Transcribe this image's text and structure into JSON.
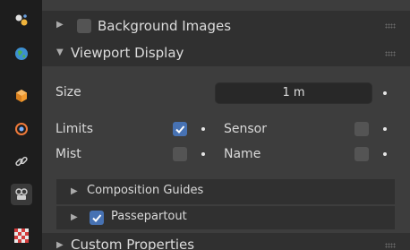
{
  "panels": {
    "background_images": {
      "label": "Background Images",
      "checked": false,
      "expanded": false
    },
    "viewport_display": {
      "label": "Viewport Display",
      "expanded": true
    },
    "custom_properties": {
      "label": "Custom Properties",
      "expanded": false
    }
  },
  "viewport_display": {
    "size": {
      "label": "Size",
      "value": "1 m"
    },
    "limits": {
      "label": "Limits",
      "checked": true
    },
    "sensor": {
      "label": "Sensor",
      "checked": false
    },
    "mist": {
      "label": "Mist",
      "checked": false
    },
    "name": {
      "label": "Name",
      "checked": false
    },
    "composition_guides": {
      "label": "Composition Guides",
      "expanded": false
    },
    "passepartout": {
      "label": "Passepartout",
      "checked": true,
      "expanded": false
    }
  },
  "sidebar_tabs": [
    {
      "icon": "scene-icon"
    },
    {
      "icon": "world-icon"
    },
    {
      "icon": "object-icon"
    },
    {
      "icon": "physics-icon"
    },
    {
      "icon": "constraints-icon"
    },
    {
      "icon": "camera-data-icon",
      "active": true
    },
    {
      "icon": "texture-icon"
    }
  ],
  "colors": {
    "accent": "#4772b3",
    "panel_bg": "#3d3d3d",
    "header_bg": "#303030",
    "tab_strip_bg": "#1d1d1d"
  }
}
